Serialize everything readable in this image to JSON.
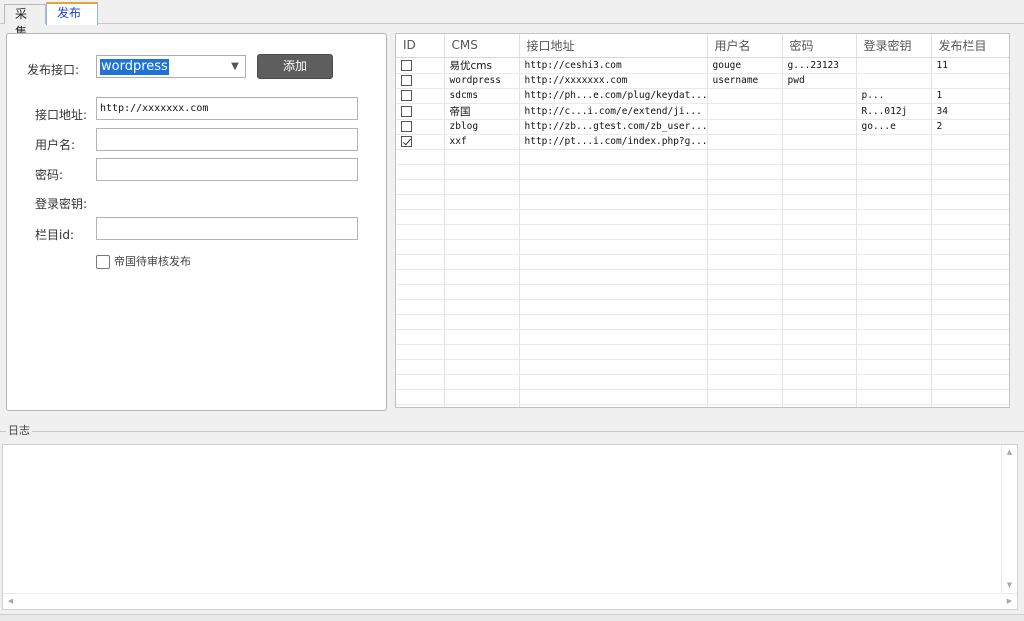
{
  "tabs": [
    {
      "label": "采集",
      "active": false
    },
    {
      "label": "发布",
      "active": true
    }
  ],
  "form": {
    "api_label": "发布接口:",
    "api_value": "wordpress",
    "add_button": "添加",
    "url_label": "接口地址:",
    "url_value": "http://xxxxxxx.com",
    "user_label": "用户名:",
    "user_value": "",
    "pwd_label": "密码:",
    "pwd_value": "",
    "key_label": "登录密钥:",
    "col_label": "栏目id:",
    "col_value": "",
    "empire_checkbox_label": "帝国待审核发布",
    "empire_checked": false
  },
  "grid": {
    "columns": [
      "ID",
      "CMS",
      "接口地址",
      "用户名",
      "密码",
      "登录密钥",
      "发布栏目"
    ],
    "rows": [
      {
        "checked": false,
        "cms": "易优cms",
        "url": "http://ceshi3.com",
        "user": "gouge",
        "pwd": "g...23123",
        "key": "",
        "col": "11"
      },
      {
        "checked": false,
        "cms": "wordpress",
        "url": "http://xxxxxxx.com",
        "user": "username",
        "pwd": "pwd",
        "key": "",
        "col": ""
      },
      {
        "checked": false,
        "cms": "sdcms",
        "url": "http://ph...e.com/plug/keydat...",
        "user": "",
        "pwd": "",
        "key": "p...",
        "col": "1"
      },
      {
        "checked": false,
        "cms": "帝国",
        "url": "http://c...i.com/e/extend/ji...",
        "user": "",
        "pwd": "",
        "key": "R...012j",
        "col": "34"
      },
      {
        "checked": false,
        "cms": "zblog",
        "url": "http://zb...gtest.com/zb_user...",
        "user": "",
        "pwd": "",
        "key": "go...e",
        "col": "2"
      },
      {
        "checked": true,
        "cms": "xxf",
        "url": "http://pt...i.com/index.php?g...",
        "user": "",
        "pwd": "",
        "key": "",
        "col": ""
      }
    ]
  },
  "log": {
    "title": "日志",
    "content": ""
  },
  "colors": {
    "accent": "#1e74d6",
    "button_bg": "#5e5e5e",
    "tab_active_text": "#1a3fd0"
  }
}
